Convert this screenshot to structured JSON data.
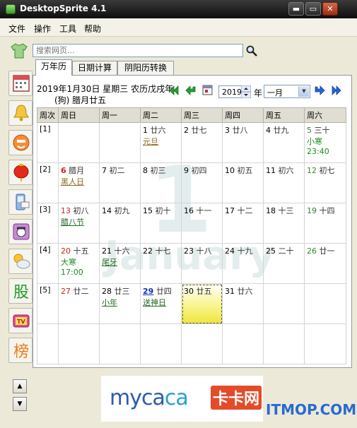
{
  "window": {
    "title": "DesktopSprite 4.1",
    "controls": {
      "minimize": "▬",
      "maximize": "▭",
      "close": "✕"
    }
  },
  "menu": [
    "文件",
    "操作",
    "工具",
    "帮助"
  ],
  "search": {
    "placeholder": "搜索网页..."
  },
  "sidebar": {
    "icons": [
      "calendar-icon",
      "bell-icon",
      "face-icon",
      "lantern-icon",
      "phone-sms-icon",
      "telephone-icon",
      "weather-icon",
      "stock-icon",
      "tv-icon",
      "ranking-icon"
    ],
    "labels": {
      "stock": "股",
      "tv": "TV",
      "rank": "榜"
    }
  },
  "tabs": [
    "万年历",
    "日期计算",
    "阴阳历转换"
  ],
  "calendar": {
    "date_line1": "2019年1月30日 星期三 农历戊戌年",
    "date_line2": "(狗) 腊月廿五",
    "year": "2019",
    "year_label": "年",
    "month": "一月",
    "watermark_number": "1",
    "watermark_month": "January",
    "headers": [
      "周次",
      "周日",
      "周一",
      "周二",
      "周三",
      "周四",
      "周五",
      "周六"
    ],
    "weeks": [
      {
        "label": "[1]",
        "days": [
          {},
          {},
          {
            "num": "1",
            "lunar": "廿六",
            "note": "元旦",
            "note_style": "brown"
          },
          {
            "num": "2",
            "lunar": "廿七"
          },
          {
            "num": "3",
            "lunar": "廿八"
          },
          {
            "num": "4",
            "lunar": "廿九"
          },
          {
            "num": "5",
            "lunar": "三十",
            "style": "green",
            "note": "小寒",
            "note_style": "term",
            "time": "23:40"
          }
        ]
      },
      {
        "label": "[2]",
        "days": [
          {
            "num": "6",
            "lunar": "腊月",
            "style": "red-bold",
            "note": "黑人日",
            "note_style": "brown"
          },
          {
            "num": "7",
            "lunar": "初二"
          },
          {
            "num": "8",
            "lunar": "初三"
          },
          {
            "num": "9",
            "lunar": "初四"
          },
          {
            "num": "10",
            "lunar": "初五"
          },
          {
            "num": "11",
            "lunar": "初六"
          },
          {
            "num": "12",
            "lunar": "初七",
            "style": "green"
          }
        ]
      },
      {
        "label": "[3]",
        "days": [
          {
            "num": "13",
            "lunar": "初八",
            "style": "red",
            "note": "腊八节",
            "note_style": "holiday"
          },
          {
            "num": "14",
            "lunar": "初九"
          },
          {
            "num": "15",
            "lunar": "初十"
          },
          {
            "num": "16",
            "lunar": "十一"
          },
          {
            "num": "17",
            "lunar": "十二"
          },
          {
            "num": "18",
            "lunar": "十三"
          },
          {
            "num": "19",
            "lunar": "十四",
            "style": "green"
          }
        ]
      },
      {
        "label": "[4]",
        "days": [
          {
            "num": "20",
            "lunar": "十五",
            "style": "red",
            "note": "大寒",
            "note_style": "term",
            "time": "17:00"
          },
          {
            "num": "21",
            "lunar": "十六",
            "note": "尾牙",
            "note_style": "holiday"
          },
          {
            "num": "22",
            "lunar": "十七"
          },
          {
            "num": "23",
            "lunar": "十八"
          },
          {
            "num": "24",
            "lunar": "十九"
          },
          {
            "num": "25",
            "lunar": "二十"
          },
          {
            "num": "26",
            "lunar": "廿一",
            "style": "green"
          }
        ]
      },
      {
        "label": "[5]",
        "days": [
          {
            "num": "27",
            "lunar": "廿二",
            "style": "red"
          },
          {
            "num": "28",
            "lunar": "廿三",
            "note": "小年",
            "note_style": "holiday"
          },
          {
            "num": "29",
            "lunar": "廿四",
            "style": "blue-ul",
            "note": "送神日",
            "note_style": "holiday"
          },
          {
            "num": "30",
            "lunar": "廿五",
            "today": true
          },
          {
            "num": "31",
            "lunar": "廿六"
          },
          {},
          {}
        ]
      },
      {
        "label": "",
        "days": [
          {},
          {},
          {},
          {},
          {},
          {},
          {}
        ]
      }
    ]
  },
  "ad": {
    "brand_part1": "myca",
    "brand_part2": "ca",
    "brand_cn": "卡卡网"
  },
  "watermark_site": "ITMOP.COM",
  "colors": {
    "sunday": "#d11f1f",
    "saturday": "#2a8a2a",
    "today_bg": "#f8f48c",
    "header_bg": "#e0ddd2"
  }
}
